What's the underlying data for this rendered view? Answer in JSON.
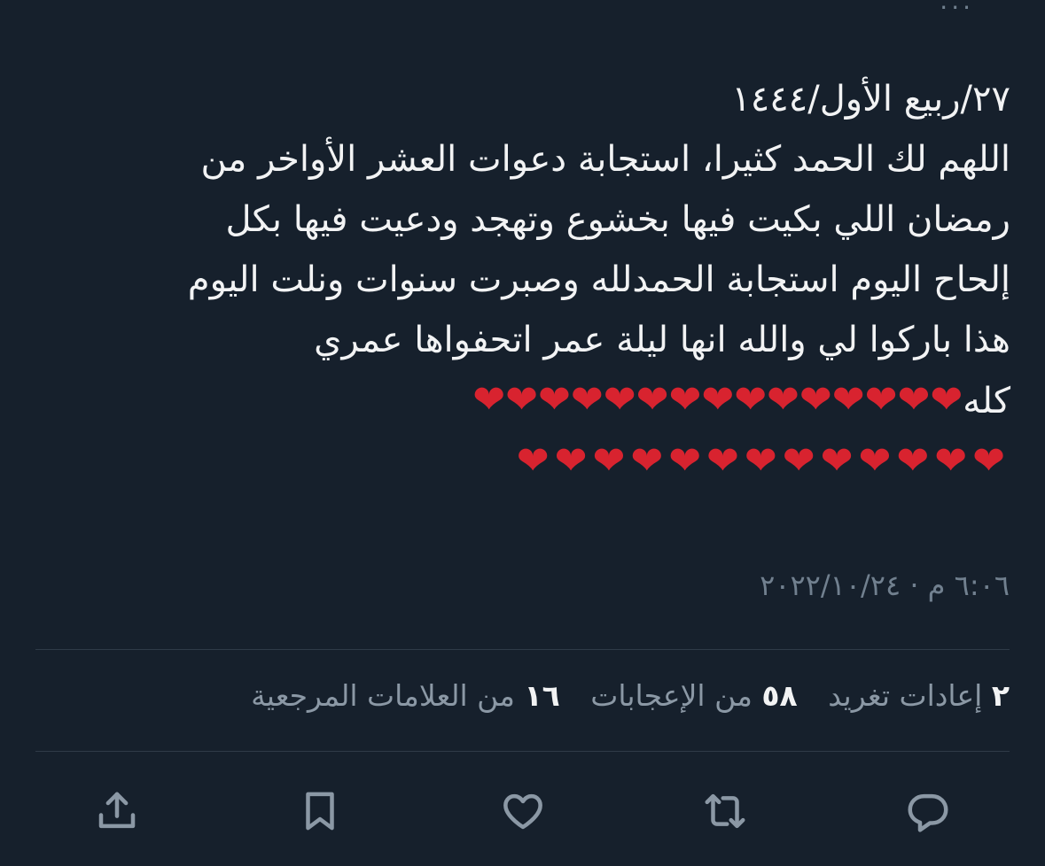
{
  "tweet": {
    "lines": [
      "٢٧/ربيع الأول/١٤٤٤",
      "اللهم لك الحمد كثيرا، استجابة دعوات العشر الأواخر من",
      "رمضان اللي بكيت فيها بخشوع وتهجد ودعيت فيها بكل",
      "إلحاح اليوم استجابة الحمدلله وصبرت سنوات ونلت اليوم",
      "هذا باركوا لي والله انها ليلة عمر اتحفواها عمري",
      "كله"
    ],
    "hearts_line1": "❤❤❤❤❤❤❤❤❤❤❤❤❤❤❤",
    "hearts_line2": "❤❤❤❤❤❤❤❤❤❤❤❤❤"
  },
  "meta": {
    "timestamp": "٦:٠٦ م · ٢٠٢٢/١٠/٢٤"
  },
  "stats": {
    "retweets_count": "٢",
    "retweets_label": "إعادات تغريد",
    "likes_count": "٥٨",
    "likes_label": "من الإعجابات",
    "bookmarks_count": "١٦",
    "bookmarks_label": "من العلامات المرجعية"
  },
  "actions": [
    {
      "name": "reply",
      "icon": "reply-icon"
    },
    {
      "name": "retweet",
      "icon": "retweet-icon"
    },
    {
      "name": "like",
      "icon": "heart-icon"
    },
    {
      "name": "bookmark",
      "icon": "bookmark-icon"
    },
    {
      "name": "share",
      "icon": "share-icon"
    }
  ],
  "colors": {
    "background": "#16202c",
    "text": "#f2f3f4",
    "muted": "#8b98a5",
    "heart": "#d8232f",
    "divider": "#2f3b48"
  }
}
